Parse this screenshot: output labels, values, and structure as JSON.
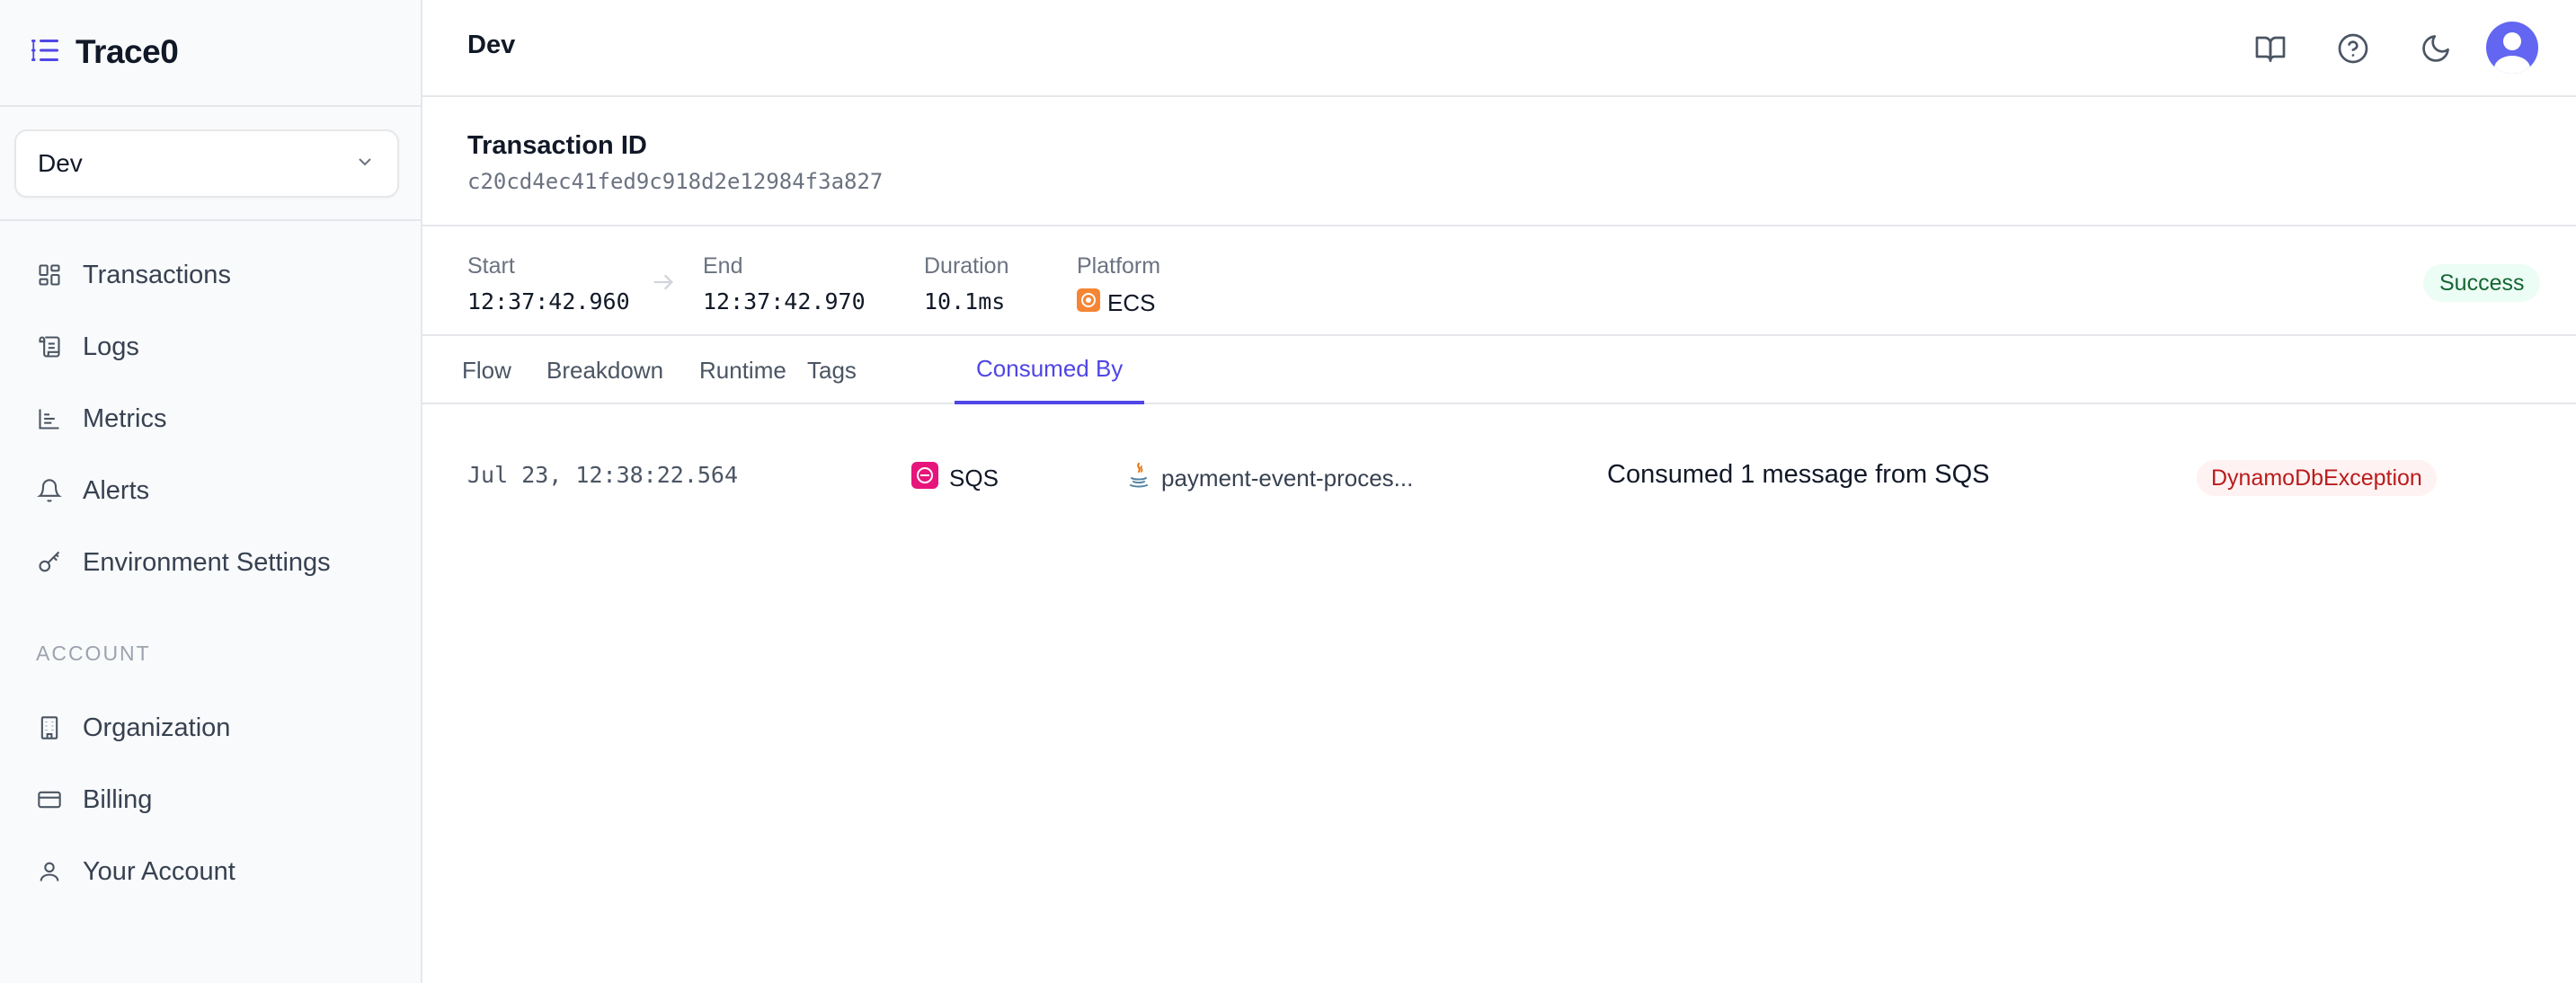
{
  "app": {
    "name": "Trace0"
  },
  "sidebar": {
    "environment": "Dev",
    "nav": [
      {
        "label": "Transactions",
        "icon": "grid-icon"
      },
      {
        "label": "Logs",
        "icon": "scroll-icon"
      },
      {
        "label": "Metrics",
        "icon": "bar-chart-icon"
      },
      {
        "label": "Alerts",
        "icon": "bell-icon"
      },
      {
        "label": "Environment Settings",
        "icon": "key-icon"
      }
    ],
    "account_heading": "ACCOUNT",
    "account": [
      {
        "label": "Organization",
        "icon": "building-icon"
      },
      {
        "label": "Billing",
        "icon": "credit-card-icon"
      },
      {
        "label": "Your Account",
        "icon": "user-icon"
      }
    ]
  },
  "header": {
    "title": "Dev",
    "icons": [
      "book-icon",
      "help-icon",
      "moon-icon",
      "avatar"
    ]
  },
  "transaction": {
    "id_label": "Transaction ID",
    "id": "c20cd4ec41fed9c918d2e12984f3a827",
    "start_label": "Start",
    "start": "12:37:42.960",
    "end_label": "End",
    "end": "12:37:42.970",
    "duration_label": "Duration",
    "duration": "10.1ms",
    "platform_label": "Platform",
    "platform": "ECS",
    "status": "Success"
  },
  "tabs": [
    "Flow",
    "Breakdown",
    "Runtime",
    "Tags",
    "Consumed By"
  ],
  "active_tab": "Consumed By",
  "consumed_by": [
    {
      "time": "Jul 23, 12:38:22.564",
      "service": "SQS",
      "consumer": "payment-event-proces...",
      "description": "Consumed 1 message from SQS",
      "error": "DynamoDbException"
    }
  ],
  "colors": {
    "accent": "#4f46e5",
    "success_bg": "#ecfdf5",
    "success_text": "#166534",
    "error_bg": "#fef2f2",
    "error_text": "#b91c1c",
    "sqs": "#e7157b",
    "ecs": "#f58534"
  }
}
